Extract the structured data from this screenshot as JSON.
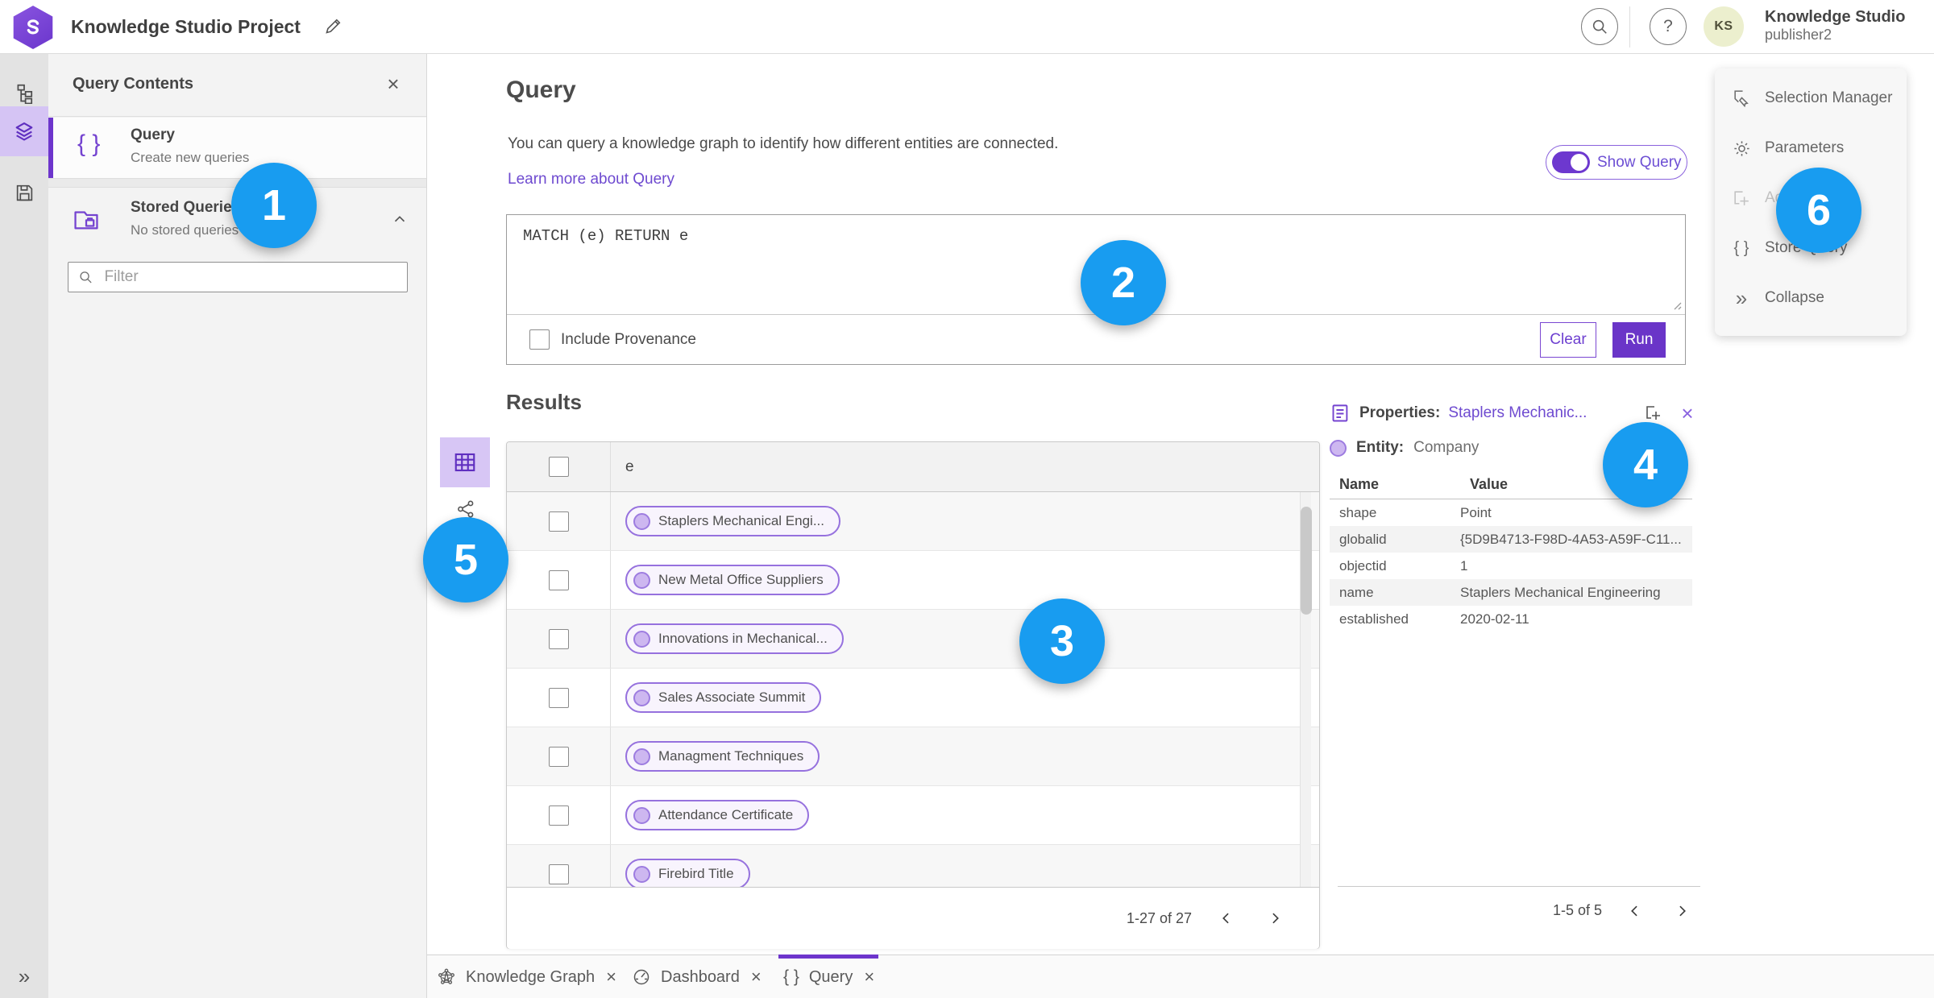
{
  "topbar": {
    "title": "Knowledge Studio Project",
    "user_name": "Knowledge Studio",
    "user_role": "publisher2",
    "avatar_initials": "KS"
  },
  "glyphs": {
    "braces": "{ }",
    "help": "?",
    "close": "×",
    "collapse_double_chevron": "»",
    "expand_double_chevron": "»"
  },
  "query_contents": {
    "title": "Query Contents",
    "items": [
      {
        "title": "Query",
        "subtitle": "Create new queries",
        "icon": "braces-icon"
      },
      {
        "title": "Stored Queries",
        "subtitle": "No stored queries exist",
        "icon": "stored-queries-folder-icon"
      }
    ],
    "filter_placeholder": "Filter"
  },
  "query_panel": {
    "heading": "Query",
    "description": "You can query a knowledge graph to identify how different entities are connected.",
    "learn_more": "Learn more about Query",
    "show_query_label": "Show Query",
    "query_text": "MATCH (e) RETURN e",
    "include_provenance_label": "Include Provenance",
    "clear_label": "Clear",
    "run_label": "Run"
  },
  "results": {
    "heading": "Results",
    "column_header": "e",
    "rows": [
      {
        "label": "Staplers Mechanical Engi..."
      },
      {
        "label": "New Metal Office Suppliers"
      },
      {
        "label": "Innovations in Mechanical..."
      },
      {
        "label": "Sales Associate Summit"
      },
      {
        "label": "Managment Techniques"
      },
      {
        "label": "Attendance Certificate"
      },
      {
        "label": "Firebird Title"
      }
    ],
    "pagination": {
      "text": "1-27 of 27"
    }
  },
  "properties": {
    "title_label": "Properties:",
    "title_link": "Staplers Mechanic...",
    "entity_label": "Entity:",
    "entity_value": "Company",
    "columns": {
      "name": "Name",
      "value": "Value"
    },
    "rows": [
      {
        "name": "shape",
        "value": "Point"
      },
      {
        "name": "globalid",
        "value": "{5D9B4713-F98D-4A53-A59F-C11..."
      },
      {
        "name": "objectid",
        "value": "1"
      },
      {
        "name": "name",
        "value": "Staplers Mechanical Engineering"
      },
      {
        "name": "established",
        "value": "2020-02-11"
      }
    ],
    "pagination": {
      "text": "1-5 of 5"
    }
  },
  "side_menu": {
    "items": [
      {
        "label": "Selection Manager",
        "icon": "selection-manager-icon",
        "disabled": false
      },
      {
        "label": "Parameters",
        "icon": "gear-icon",
        "disabled": false
      },
      {
        "label": "Ad",
        "icon": "add-to-icon",
        "disabled": true
      },
      {
        "label": "Store Query",
        "icon": "braces-icon",
        "disabled": false
      },
      {
        "label": "Collapse",
        "icon": "double-chevron-icon",
        "disabled": false
      }
    ]
  },
  "tabs": [
    {
      "label": "Knowledge Graph",
      "icon": "knowledge-graph-icon",
      "active": false
    },
    {
      "label": "Dashboard",
      "icon": "dashboard-icon",
      "active": false
    },
    {
      "label": "Query",
      "icon": "braces-icon",
      "active": true
    }
  ],
  "annotations": [
    {
      "number": "1"
    },
    {
      "number": "2"
    },
    {
      "number": "3"
    },
    {
      "number": "4"
    },
    {
      "number": "5"
    },
    {
      "number": "6"
    }
  ],
  "colors": {
    "accent_purple": "#6a35c8",
    "light_purple": "#d7c6f5",
    "annotation_blue": "#189cf0",
    "link_purple": "#6e4ad0"
  }
}
